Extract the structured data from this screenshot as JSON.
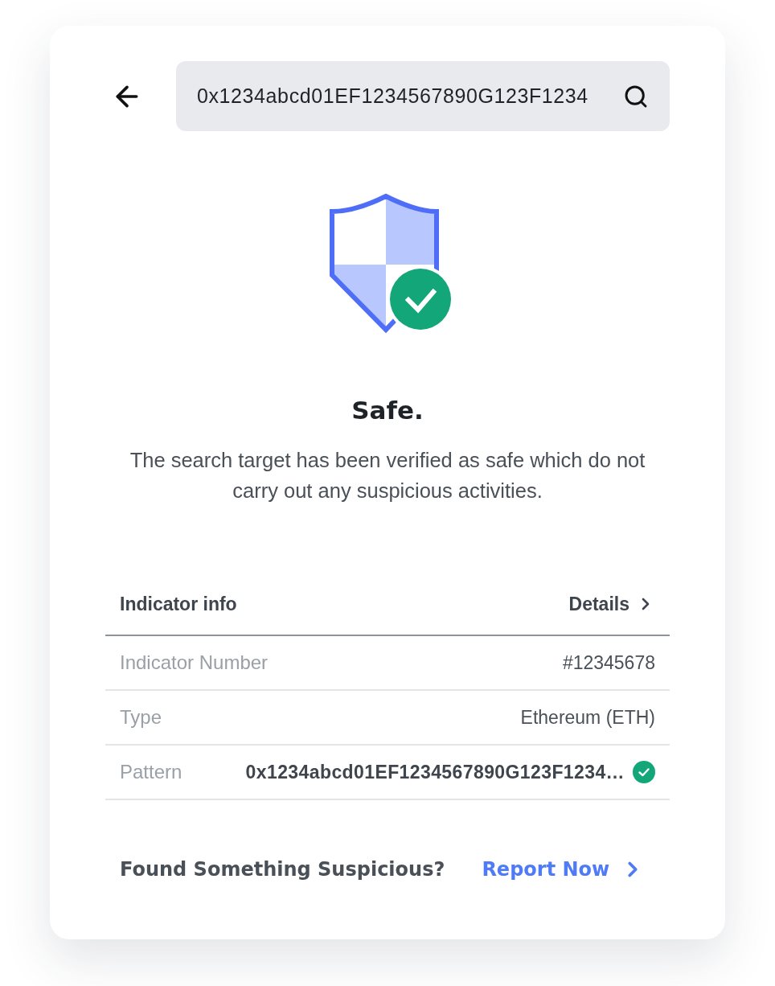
{
  "search": {
    "value": "0x1234abcd01EF1234567890G123F1234"
  },
  "result": {
    "kind": "safe",
    "title": "Safe.",
    "description": "The search target has been verified as safe which do not carry out any suspicious activities."
  },
  "indicator": {
    "title": "Indicator info",
    "details_link": "Details",
    "rows": [
      {
        "label": "Indicator Number",
        "value": "#12345678",
        "kind": "plain",
        "verified": false
      },
      {
        "label": "Type",
        "value": "Ethereum (ETH)",
        "kind": "plain",
        "verified": false
      },
      {
        "label": "Pattern",
        "value": "0x1234abcd01EF1234567890G123F1234…",
        "kind": "code",
        "verified": true
      }
    ]
  },
  "report": {
    "prompt": "Found Something Suspicious?",
    "link": "Report Now"
  }
}
